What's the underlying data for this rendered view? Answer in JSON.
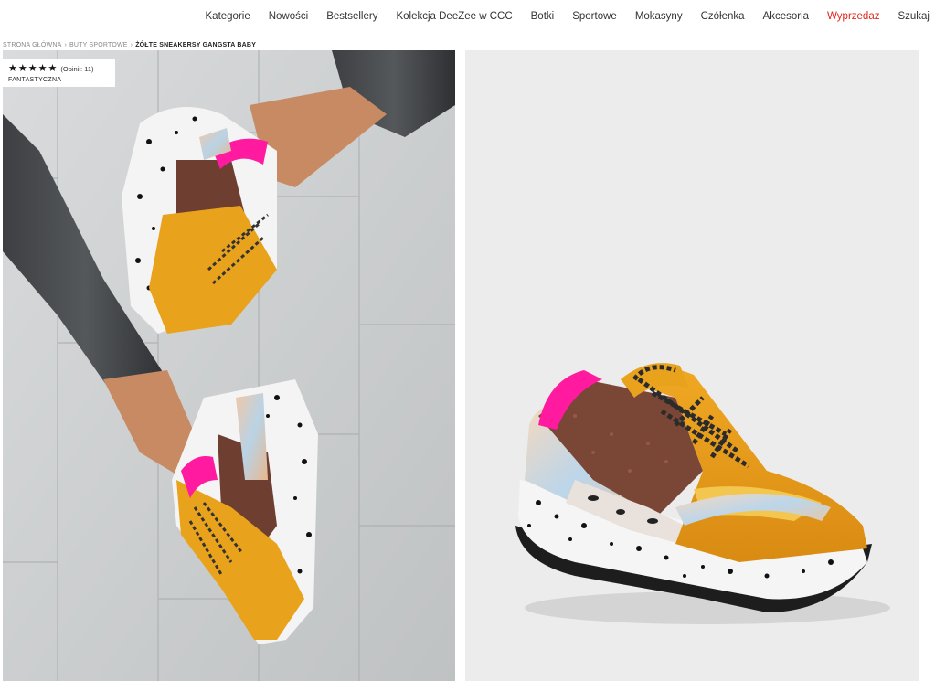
{
  "nav": {
    "items": [
      {
        "label": "Kategorie"
      },
      {
        "label": "Nowości"
      },
      {
        "label": "Bestsellery"
      },
      {
        "label": "Kolekcja DeeZee w CCC"
      },
      {
        "label": "Botki"
      },
      {
        "label": "Sportowe"
      },
      {
        "label": "Mokasyny"
      },
      {
        "label": "Czółenka"
      },
      {
        "label": "Akcesoria"
      },
      {
        "label": "Wyprzedaż"
      },
      {
        "label": "Szukaj"
      }
    ],
    "sale_color": "#e3261c"
  },
  "breadcrumb": {
    "items": [
      "STRONA GŁÓWNA",
      "BUTY SPORTOWE",
      "ŻÓŁTE SNEAKERSY GANGSTA BABY"
    ],
    "separator": "›"
  },
  "rating": {
    "stars": 5,
    "star_glyph": "★",
    "opinions": "(Opinii: 11)",
    "label": "FANTASTYCZNA"
  },
  "images": {
    "left": {
      "icon": "product-lifestyle-photo"
    },
    "right": {
      "icon": "product-studio-photo"
    }
  },
  "colors": {
    "accent_sale": "#e3261c",
    "shoe_yellow": "#e8a21c",
    "shoe_pink": "#ff1aa0",
    "glitter": "#7a4636"
  }
}
